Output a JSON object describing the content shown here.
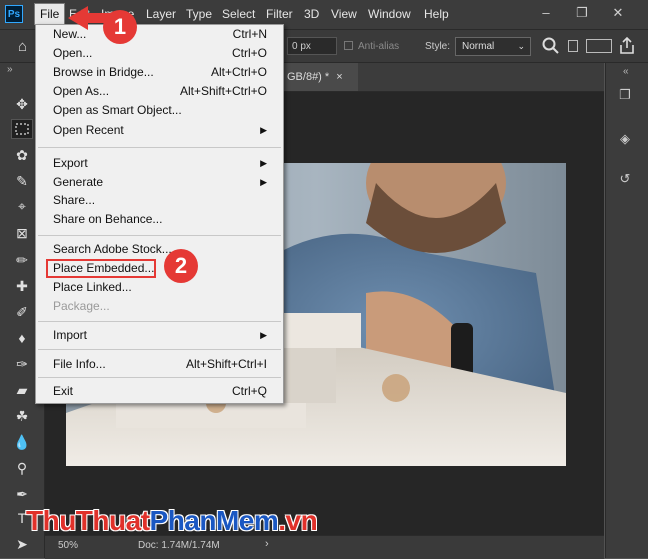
{
  "app": {
    "logo": "Ps"
  },
  "menubar": {
    "items": [
      "File",
      "Edit",
      "Image",
      "Layer",
      "Type",
      "Select",
      "Filter",
      "3D",
      "View",
      "Window",
      "Help"
    ],
    "window_controls": [
      "minimize-icon",
      "restore-icon",
      "close-icon"
    ]
  },
  "options_bar": {
    "feather_value": "0 px",
    "antialias_label": "Anti-alias",
    "style_label": "Style:",
    "style_value": "Normal"
  },
  "tab": {
    "title": "GB/8#) *",
    "close": "×"
  },
  "status": {
    "zoom": "50%",
    "doc_size": "Doc: 1.74M/1.74M",
    "arrow": "›"
  },
  "file_menu": {
    "items": [
      {
        "label": "New...",
        "shortcut": "Ctrl+N"
      },
      {
        "label": "Open...",
        "shortcut": "Ctrl+O"
      },
      {
        "label": "Browse in Bridge...",
        "shortcut": "Alt+Ctrl+O"
      },
      {
        "label": "Open As...",
        "shortcut": "Alt+Shift+Ctrl+O"
      },
      {
        "label": "Open as Smart Object...",
        "shortcut": ""
      },
      {
        "label": "Open Recent",
        "shortcut": "",
        "submenu": true
      },
      {
        "label": "Export",
        "shortcut": "",
        "submenu": true
      },
      {
        "label": "Generate",
        "shortcut": "",
        "submenu": true
      },
      {
        "label": "Share...",
        "shortcut": ""
      },
      {
        "label": "Share on Behance...",
        "shortcut": ""
      },
      {
        "label": "Search Adobe Stock...",
        "shortcut": ""
      },
      {
        "label": "Place Embedded...",
        "shortcut": ""
      },
      {
        "label": "Place Linked...",
        "shortcut": ""
      },
      {
        "label": "Package...",
        "shortcut": "",
        "disabled": true
      },
      {
        "label": "Import",
        "shortcut": "",
        "submenu": true
      },
      {
        "label": "File Info...",
        "shortcut": "Alt+Shift+Ctrl+I"
      },
      {
        "label": "Exit",
        "shortcut": "Ctrl+Q"
      }
    ]
  },
  "callouts": [
    "1",
    "2"
  ],
  "watermark": {
    "part1": "ThuThuat",
    "part2": "PhanMem",
    "part3": ".vn"
  },
  "colors": {
    "accent_red": "#e53935",
    "menu_bg": "#f0f0f0",
    "chrome_bg": "#3c3c3c",
    "ps_blue": "#31a8ff"
  }
}
